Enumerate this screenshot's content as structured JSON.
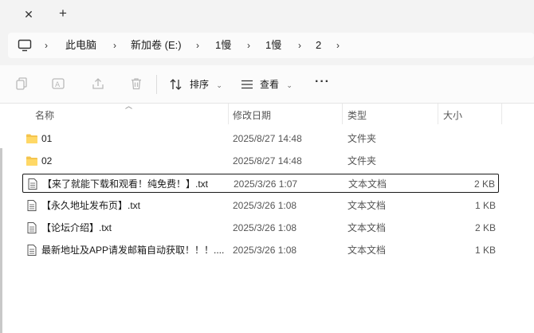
{
  "tabs": {
    "close": "✕",
    "new": "+"
  },
  "breadcrumb": {
    "items": [
      "此电脑",
      "新加卷 (E:)",
      "1慢",
      "1慢",
      "2"
    ],
    "chevron": "›"
  },
  "toolbar": {
    "sort_label": "排序",
    "view_label": "查看",
    "more": "···",
    "icons": [
      "copy-icon",
      "rename-icon",
      "share-icon",
      "delete-icon",
      "sort-icon",
      "view-icon"
    ]
  },
  "columns": {
    "name": "名称",
    "date": "修改日期",
    "type": "类型",
    "size": "大小"
  },
  "files": [
    {
      "name": "01",
      "date": "2025/8/27 14:48",
      "type": "文件夹",
      "size": "",
      "kind": "folder"
    },
    {
      "name": "02",
      "date": "2025/8/27 14:48",
      "type": "文件夹",
      "size": "",
      "kind": "folder"
    },
    {
      "name": "【来了就能下载和观看！纯免费！】.txt",
      "date": "2025/3/26 1:07",
      "type": "文本文档",
      "size": "2 KB",
      "kind": "txt"
    },
    {
      "name": "【永久地址发布页】.txt",
      "date": "2025/3/26 1:08",
      "type": "文本文档",
      "size": "1 KB",
      "kind": "txt"
    },
    {
      "name": "【论坛介绍】.txt",
      "date": "2025/3/26 1:08",
      "type": "文本文档",
      "size": "2 KB",
      "kind": "txt"
    },
    {
      "name": "最新地址及APP请发邮箱自动获取！！！....",
      "date": "2025/3/26 1:08",
      "type": "文本文档",
      "size": "1 KB",
      "kind": "txt"
    }
  ],
  "colors": {
    "folder": "#f4c44e",
    "accent": "#0067c0",
    "chrome": "#f3f3f3"
  }
}
